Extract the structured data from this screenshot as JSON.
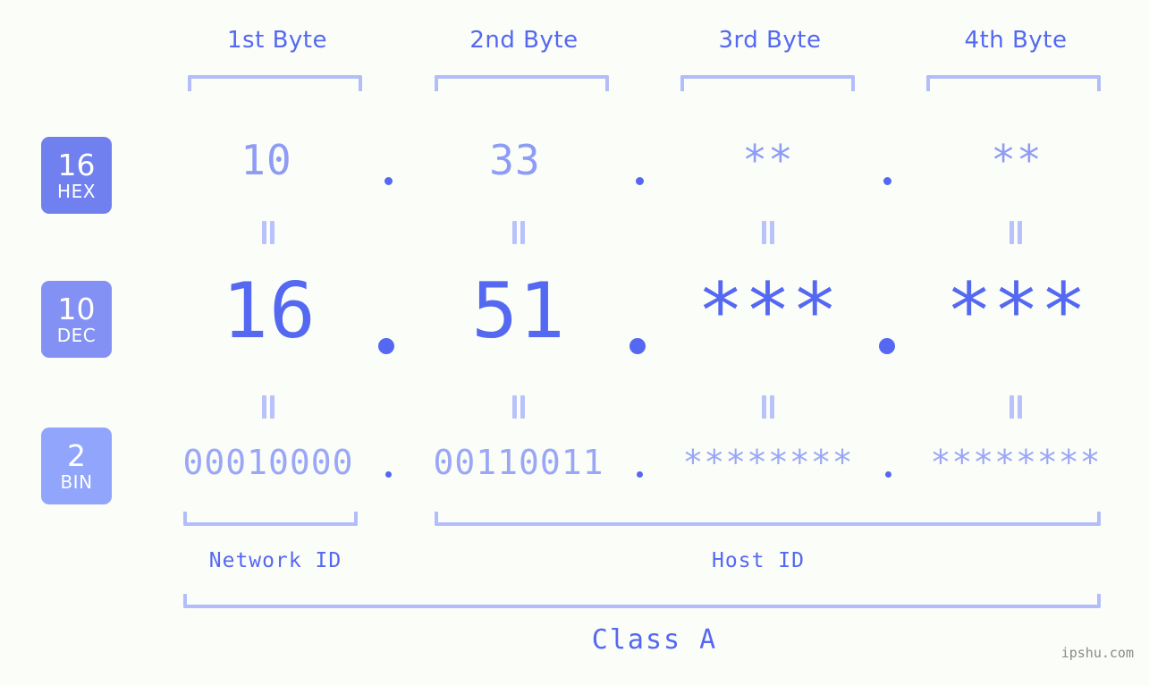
{
  "background_color": "#fbfdf8",
  "accent_color": "#5468f2",
  "accent_light_color": "#8e9cf5",
  "bracket_color": "#b3bdfb",
  "headers": [
    {
      "label": "1st Byte"
    },
    {
      "label": "2nd Byte"
    },
    {
      "label": "3rd Byte"
    },
    {
      "label": "4th Byte"
    }
  ],
  "rows": [
    {
      "id": "hex",
      "badge_number": "16",
      "badge_abbr": "HEX",
      "badge_color": "#7080ee",
      "values": [
        "10",
        "33",
        "**",
        "**"
      ],
      "separator": "."
    },
    {
      "id": "dec",
      "badge_number": "10",
      "badge_abbr": "DEC",
      "badge_color": "#8491f4",
      "values": [
        "16",
        "51",
        "***",
        "***"
      ],
      "separator": "."
    },
    {
      "id": "bin",
      "badge_number": "2",
      "badge_abbr": "BIN",
      "badge_color": "#90a5fb",
      "values": [
        "00010000",
        "00110011",
        "********",
        "********"
      ],
      "separator": "."
    }
  ],
  "equals_symbol": "||",
  "sections": [
    {
      "label": "Network ID"
    },
    {
      "label": "Host ID"
    }
  ],
  "class": {
    "label": "Class A"
  },
  "watermark": {
    "text": "ipshu.com"
  }
}
